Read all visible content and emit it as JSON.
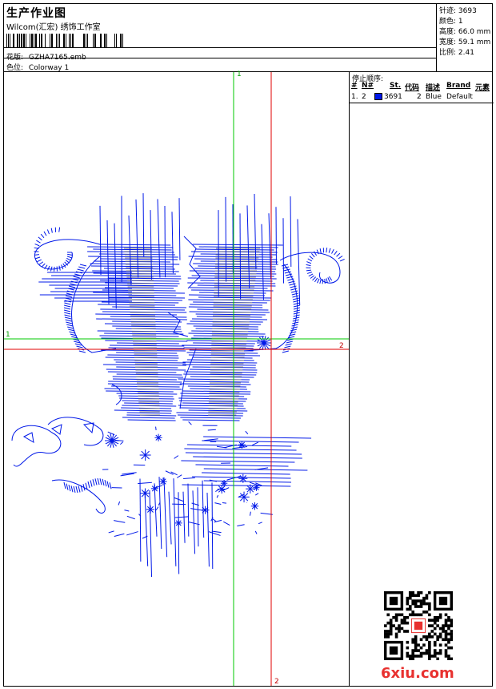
{
  "header": {
    "title": "生产作业图",
    "company": "Wilcom(汇宏) 绣饰工作室",
    "design_label": "花版:",
    "design_value": "GZHA7165.emb",
    "colorway_label": "色位:",
    "colorway_value": "Colorway 1"
  },
  "stats": {
    "stitches": "针迹: 3693",
    "colors": "颜色: 1",
    "height": "高度: 66.0 mm",
    "width": "宽度: 59.1 mm",
    "scale": "比例: 2.41"
  },
  "stop_sequence": {
    "title": "停止顺序:",
    "columns": [
      "#",
      "N#",
      "St.",
      "代码",
      "描述",
      "Brand",
      "元素"
    ],
    "rows": [
      {
        "index": "1.",
        "needle": "2",
        "stitches": "3691",
        "code": "2",
        "description": "Blue",
        "brand": "Default",
        "color": "#0018e8"
      }
    ]
  },
  "axes": {
    "vertical_top": "1",
    "horizontal_left": "1",
    "horizontal_right": "2",
    "vertical_bottom": "2"
  },
  "design_color": "#0018e8",
  "watermark": "6xiu.com"
}
